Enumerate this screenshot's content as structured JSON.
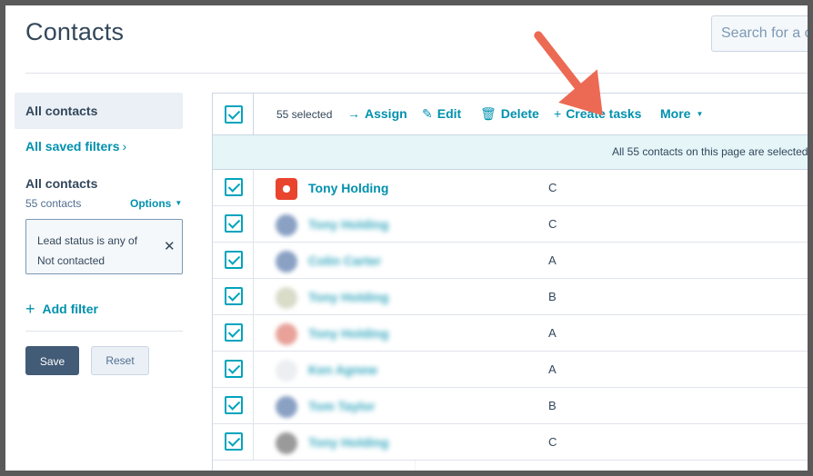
{
  "header": {
    "title": "Contacts",
    "search_placeholder": "Search for a c"
  },
  "sidebar": {
    "all_contacts": "All contacts",
    "saved_filters": "All saved filters",
    "view_title": "All contacts",
    "count": "55 contacts",
    "options": "Options",
    "filter": {
      "line1": "Lead status is any of",
      "line2": "Not contacted"
    },
    "add_filter": "Add filter",
    "save": "Save",
    "reset": "Reset"
  },
  "toolbar": {
    "selected": "55 selected",
    "assign": "Assign",
    "edit": "Edit",
    "delete": "Delete",
    "create_tasks": "Create tasks",
    "more": "More"
  },
  "banner": "All 55 contacts on this page are selected.",
  "rows": [
    {
      "name": "Tony Holding",
      "status": "C",
      "avatar_color": "#e8442e",
      "blurred": false
    },
    {
      "name": "Tony Holding",
      "status": "C",
      "avatar_color": "#8aa1c4",
      "blurred": true
    },
    {
      "name": "Colin Carter",
      "status": "A",
      "avatar_color": "#8aa1c4",
      "blurred": true
    },
    {
      "name": "Tony Holding",
      "status": "B",
      "avatar_color": "#d9dcc9",
      "blurred": true
    },
    {
      "name": "Tony Holding",
      "status": "A",
      "avatar_color": "#e8a29a",
      "blurred": true
    },
    {
      "name": "Ken Agnew",
      "status": "A",
      "avatar_color": "#eceef2",
      "blurred": true
    },
    {
      "name": "Tom Taylor",
      "status": "B",
      "avatar_color": "#8aa1c4",
      "blurred": true
    },
    {
      "name": "Tony Holding",
      "status": "C",
      "avatar_color": "#9a9a9a",
      "blurred": true
    }
  ],
  "colors": {
    "accent": "#0091ae",
    "checkbox": "#00a4bd",
    "annotation_arrow": "#ec6a54"
  }
}
